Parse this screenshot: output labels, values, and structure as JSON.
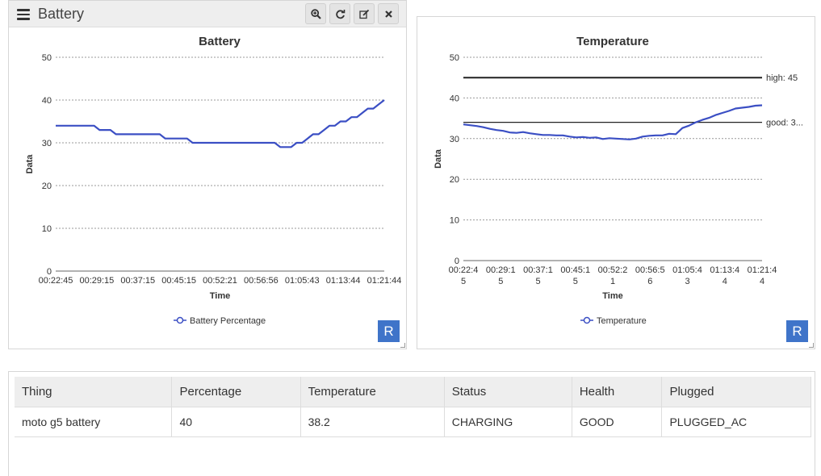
{
  "battery_panel": {
    "title": "Battery",
    "r_button": "R",
    "toolbar": {
      "zoom_icon": "search-plus-icon",
      "refresh_icon": "refresh-icon",
      "edit_icon": "edit-icon",
      "close_icon": "close-icon"
    }
  },
  "temperature_panel": {
    "r_button": "R"
  },
  "colors": {
    "series": "#3b4fc4",
    "accent_button": "#3f74c9",
    "header_bg": "#eeeeee"
  },
  "chart_data": [
    {
      "type": "line",
      "title": "Battery",
      "xlabel": "Time",
      "ylabel": "Data",
      "ylim": [
        0,
        50
      ],
      "yticks": [
        "0",
        "10",
        "20",
        "30",
        "40",
        "50"
      ],
      "x_tick_labels": [
        "00:22:45",
        "00:29:15",
        "00:37:15",
        "00:45:15",
        "00:52:21",
        "00:56:56",
        "01:05:43",
        "01:13:44",
        "01:21:44"
      ],
      "grid": true,
      "legend_position": "bottom",
      "series": [
        {
          "name": "Battery Percentage",
          "values": [
            34,
            34,
            34,
            34,
            34,
            34,
            34,
            34,
            33,
            33,
            33,
            32,
            32,
            32,
            32,
            32,
            32,
            32,
            32,
            32,
            31,
            31,
            31,
            31,
            31,
            30,
            30,
            30,
            30,
            30,
            30,
            30,
            30,
            30,
            30,
            30,
            30,
            30,
            30,
            30,
            30,
            29,
            29,
            29,
            30,
            30,
            31,
            32,
            32,
            33,
            34,
            34,
            35,
            35,
            36,
            36,
            37,
            38,
            38,
            39,
            40
          ]
        }
      ]
    },
    {
      "type": "line",
      "title": "Temperature",
      "xlabel": "Time",
      "ylabel": "Data",
      "ylim": [
        0,
        50
      ],
      "yticks": [
        "0",
        "10",
        "20",
        "30",
        "40",
        "50"
      ],
      "x_tick_labels": [
        "00:22:45",
        "00:29:15",
        "00:37:15",
        "00:45:15",
        "00:52:21",
        "00:56:56",
        "01:05:43",
        "01:13:44",
        "01:21:44"
      ],
      "grid": true,
      "legend_position": "bottom",
      "reference_lines": [
        {
          "label": "high: 45",
          "value": 45
        },
        {
          "label": "good: 3...",
          "value": 34
        }
      ],
      "series": [
        {
          "name": "Temperature",
          "values": [
            33.5,
            33.3,
            33.1,
            32.8,
            32.4,
            32.1,
            31.9,
            31.5,
            31.4,
            31.6,
            31.3,
            31.1,
            30.9,
            30.9,
            30.8,
            30.8,
            30.5,
            30.3,
            30.4,
            30.2,
            30.3,
            29.9,
            30.1,
            30.0,
            29.9,
            29.8,
            30.0,
            30.5,
            30.7,
            30.8,
            30.8,
            31.2,
            31.1,
            32.6,
            33.2,
            34.0,
            34.6,
            35.1,
            35.8,
            36.3,
            36.8,
            37.4,
            37.6,
            37.8,
            38.1,
            38.2
          ]
        }
      ]
    }
  ],
  "table": {
    "headers": [
      "Thing",
      "Percentage",
      "Temperature",
      "Status",
      "Health",
      "Plugged"
    ],
    "rows": [
      [
        "moto g5 battery",
        "40",
        "38.2",
        "CHARGING",
        "GOOD",
        "PLUGGED_AC"
      ]
    ]
  }
}
